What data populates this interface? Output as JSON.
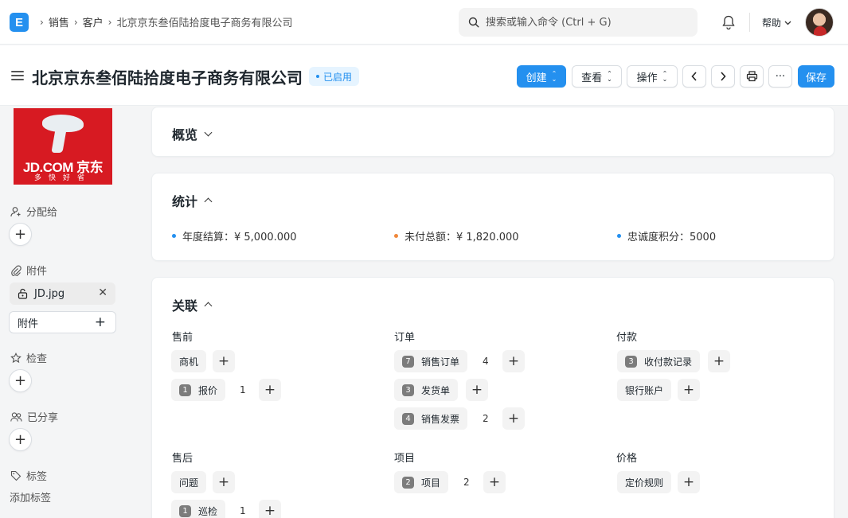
{
  "navbar": {
    "logo_letter": "E",
    "breadcrumbs": [
      "销售",
      "客户",
      "北京京东叁佰陆拾度电子商务有限公司"
    ],
    "search_placeholder": "搜索或输入命令 (Ctrl + G)",
    "help_label": "帮助"
  },
  "header": {
    "title": "北京京东叁佰陆拾度电子商务有限公司",
    "status": "已启用",
    "create_label": "创建",
    "view_label": "查看",
    "actions_label": "操作",
    "save_label": "保存",
    "more_label": "···"
  },
  "sidebar": {
    "logo_text": "JD.COM 京东",
    "logo_sub": "多快好省",
    "assign_label": "分配给",
    "attachments_label": "附件",
    "attachment_file": "JD.jpg",
    "attach_button_label": "附件",
    "review_label": "检查",
    "shared_label": "已分享",
    "tags_label": "标签",
    "add_tag_label": "添加标签"
  },
  "sections": {
    "overview": {
      "title": "概览"
    },
    "stats": {
      "title": "统计",
      "items": [
        {
          "label": "年度结算：¥ 5,000.000",
          "color": "#2490ef"
        },
        {
          "label": "未付总额：¥ 1,820.000",
          "color": "#f0883b"
        },
        {
          "label": "忠诚度积分：5000",
          "color": "#2490ef"
        }
      ]
    },
    "connections": {
      "title": "关联",
      "groups": [
        {
          "title": "售前",
          "items": [
            {
              "label": "商机",
              "badge": "",
              "count": ""
            },
            {
              "label": "报价",
              "badge": "1",
              "count": "1"
            }
          ]
        },
        {
          "title": "订单",
          "items": [
            {
              "label": "销售订单",
              "badge": "7",
              "count": "4"
            },
            {
              "label": "发货单",
              "badge": "3",
              "count": ""
            },
            {
              "label": "销售发票",
              "badge": "4",
              "count": "2"
            }
          ]
        },
        {
          "title": "付款",
          "items": [
            {
              "label": "收付款记录",
              "badge": "3",
              "count": ""
            },
            {
              "label": "银行账户",
              "badge": "",
              "count": ""
            }
          ]
        },
        {
          "title": "售后",
          "items": [
            {
              "label": "问题",
              "badge": "",
              "count": ""
            },
            {
              "label": "巡检",
              "badge": "1",
              "count": "1"
            }
          ]
        },
        {
          "title": "项目",
          "items": [
            {
              "label": "项目",
              "badge": "2",
              "count": "2"
            }
          ]
        },
        {
          "title": "价格",
          "items": [
            {
              "label": "定价规则",
              "badge": "",
              "count": ""
            }
          ]
        }
      ]
    }
  },
  "colors": {
    "primary": "#2490ef",
    "warning": "#f0883b"
  }
}
